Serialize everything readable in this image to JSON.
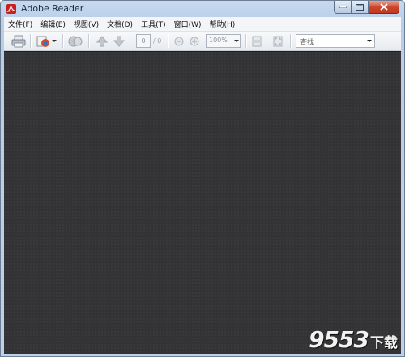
{
  "window": {
    "title": "Adobe Reader"
  },
  "menubar": {
    "items": [
      {
        "label": "文件(F)"
      },
      {
        "label": "编辑(E)"
      },
      {
        "label": "视图(V)"
      },
      {
        "label": "文档(D)"
      },
      {
        "label": "工具(T)"
      },
      {
        "label": "窗口(W)"
      },
      {
        "label": "帮助(H)"
      }
    ]
  },
  "toolbar": {
    "page_number": "0",
    "page_total": "/ 0",
    "zoom": "100%",
    "search_placeholder": "查找",
    "icons": [
      "print-icon",
      "create-pdf-icon",
      "share-icon",
      "previous-page-icon",
      "next-page-icon",
      "zoom-out-icon",
      "zoom-in-icon",
      "fit-page-icon",
      "full-screen-icon"
    ]
  },
  "watermark": {
    "number": "9553",
    "text": "下载"
  },
  "colors": {
    "document_background": "#333335",
    "close_button": "#c9442a",
    "watermark_accent": "#e2231a"
  }
}
